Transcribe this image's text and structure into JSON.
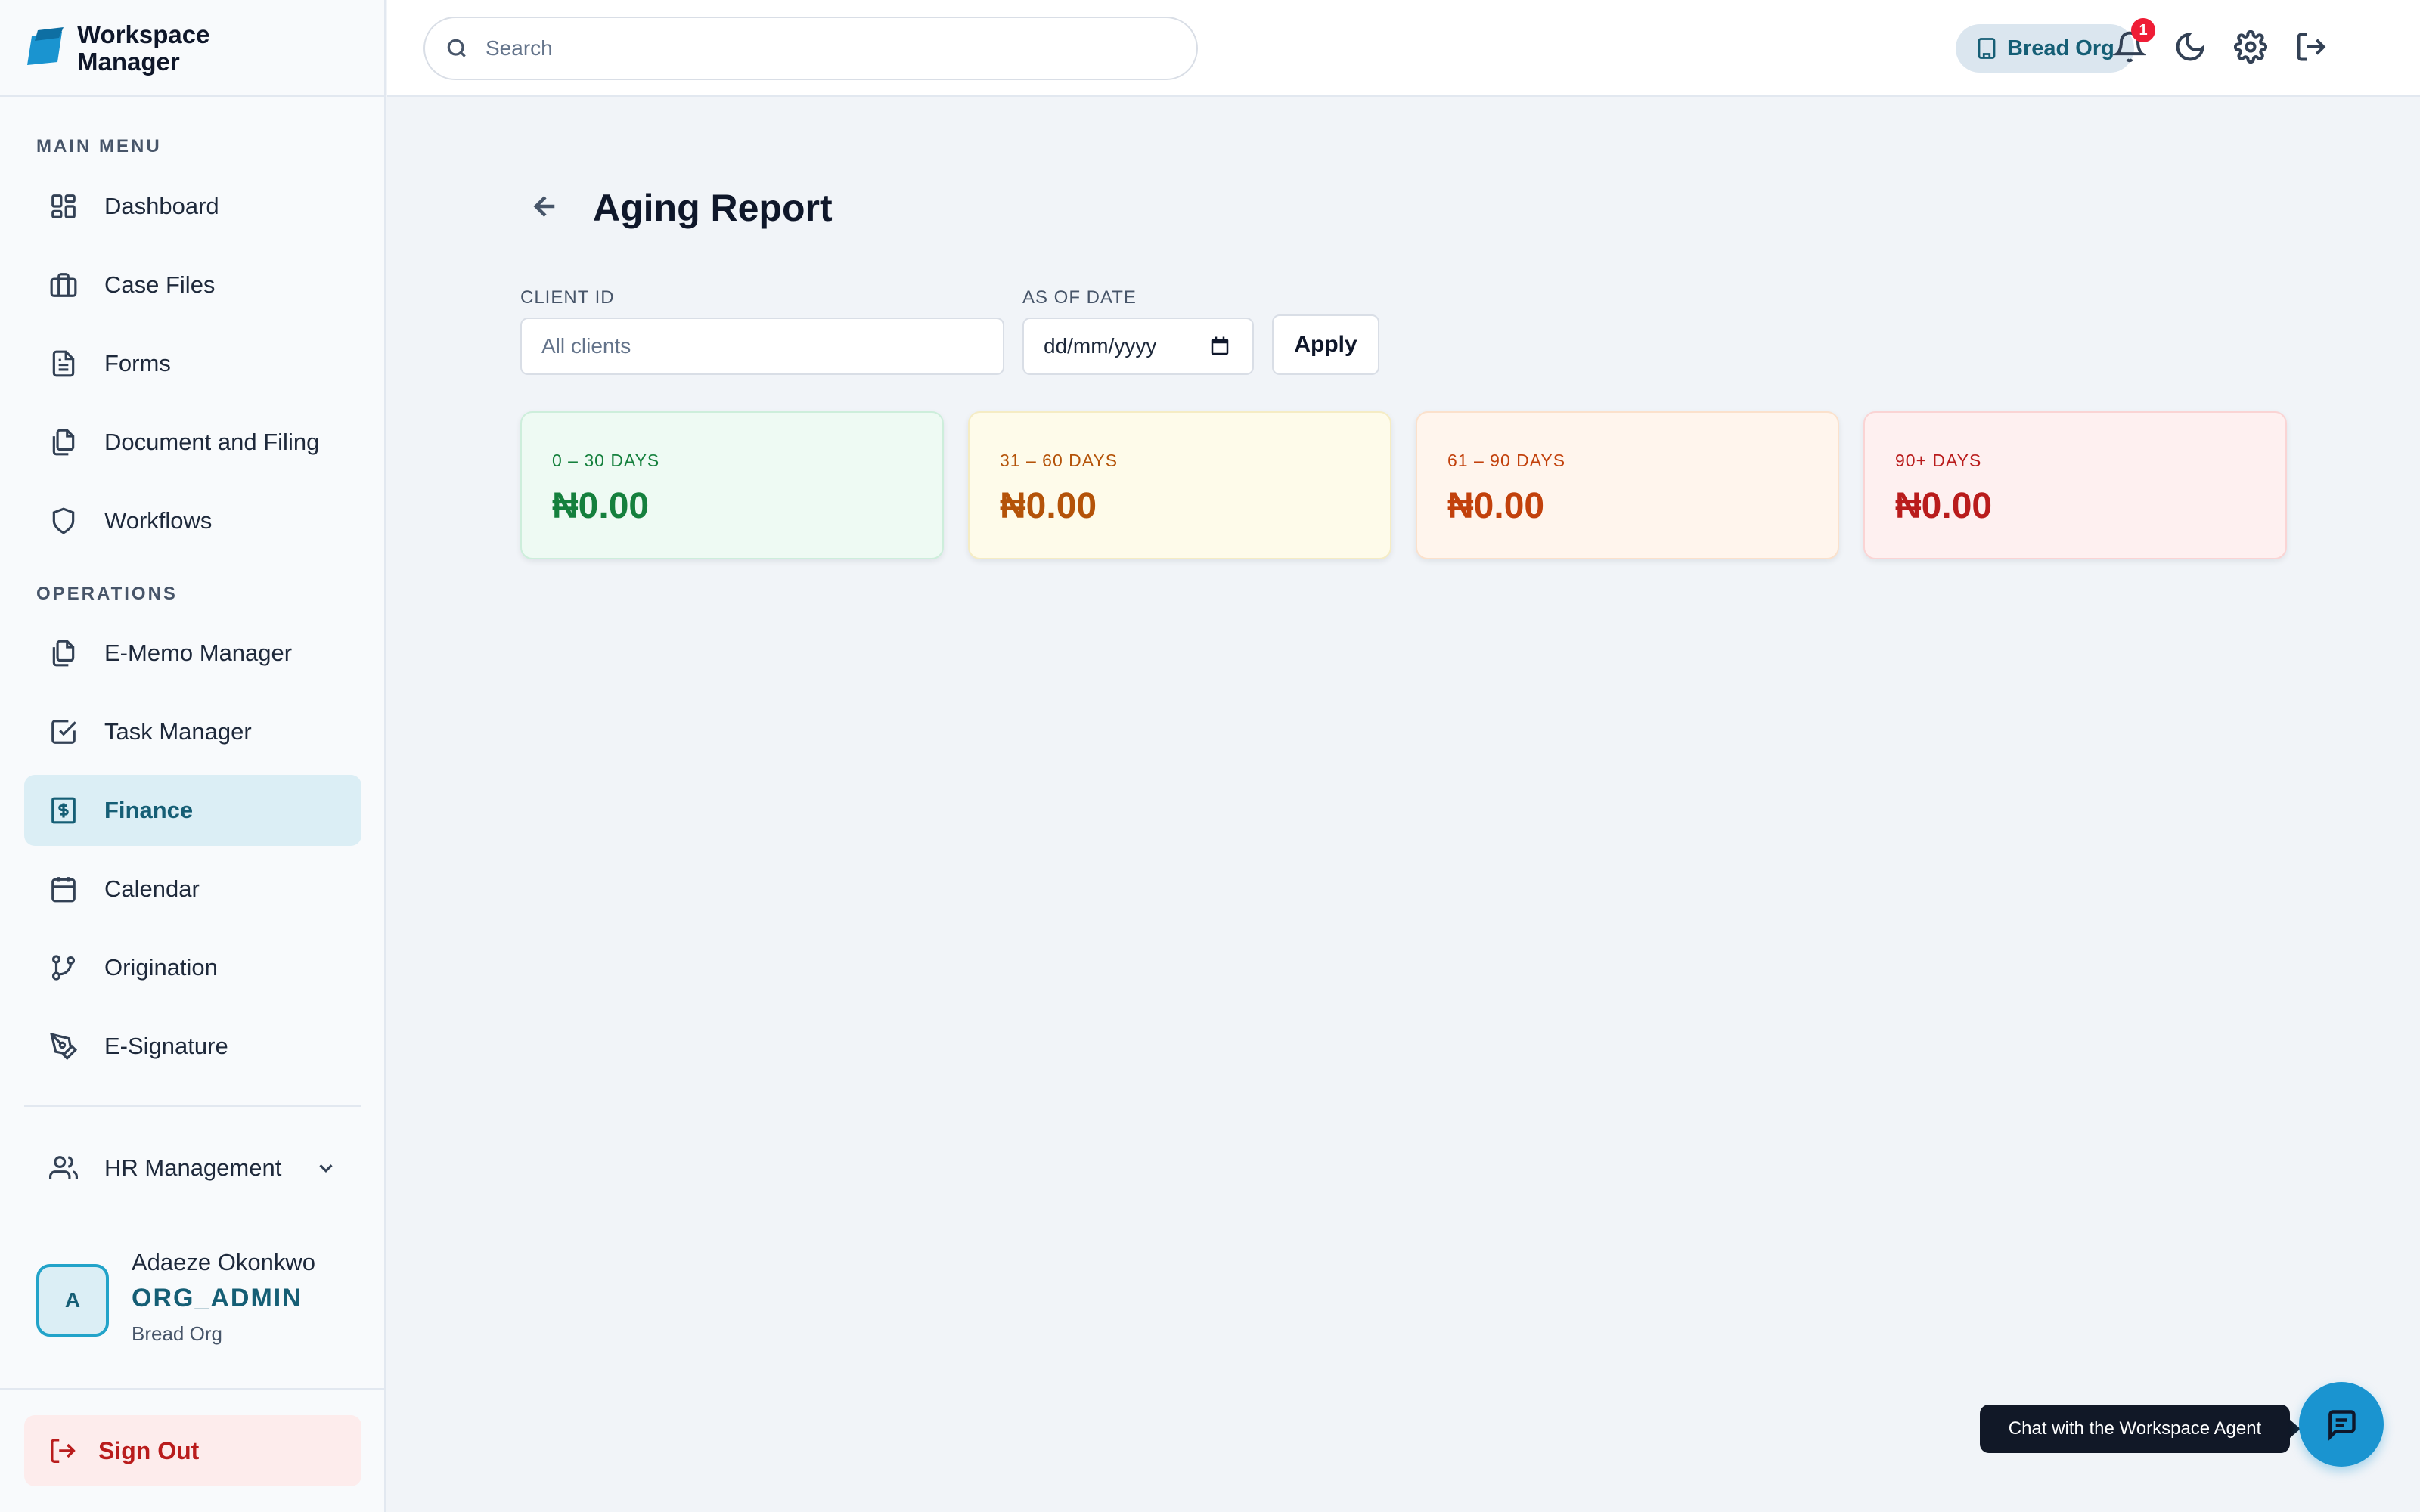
{
  "app": {
    "name": "Workspace Manager"
  },
  "sidebar": {
    "sections": [
      {
        "title": "MAIN MENU"
      },
      {
        "title": "OPERATIONS"
      }
    ],
    "items": [
      {
        "label": "Dashboard",
        "icon": "grid-icon"
      },
      {
        "label": "Case Files",
        "icon": "briefcase-icon"
      },
      {
        "label": "Forms",
        "icon": "document-icon"
      },
      {
        "label": "Document and Filing",
        "icon": "files-icon"
      },
      {
        "label": "Workflows",
        "icon": "shield-icon"
      },
      {
        "label": "E-Memo Manager",
        "icon": "files-icon"
      },
      {
        "label": "Task Manager",
        "icon": "checkbox-icon"
      },
      {
        "label": "Finance",
        "icon": "dollar-receipt-icon",
        "active": true
      },
      {
        "label": "Calendar",
        "icon": "calendar-icon"
      },
      {
        "label": "Origination",
        "icon": "git-branch-icon"
      },
      {
        "label": "E-Signature",
        "icon": "pen-tool-icon"
      }
    ],
    "hr": {
      "label": "HR Management",
      "icon": "users-icon"
    },
    "user": {
      "initial": "A",
      "name": "Adaeze Okonkwo",
      "role": "ORG_ADMIN",
      "org": "Bread Org"
    },
    "signout_label": "Sign Out"
  },
  "header": {
    "search_placeholder": "Search",
    "org_name": "Bread Org",
    "notification_count": "1"
  },
  "page": {
    "title": "Aging Report",
    "filters": {
      "client_label": "CLIENT ID",
      "client_placeholder": "All clients",
      "date_label": "AS OF DATE",
      "date_placeholder": "dd/mm/yyyy",
      "apply_label": "Apply"
    },
    "buckets": [
      {
        "label": "0 – 30 DAYS",
        "value": "₦0.00",
        "text_color": "#15803d",
        "label_color": "#15803d",
        "bg": "#eefaf3",
        "border": "#cdeedb"
      },
      {
        "label": "31 – 60 DAYS",
        "value": "₦0.00",
        "text_color": "#b45309",
        "label_color": "#b45309",
        "bg": "#fefbea",
        "border": "#f5ecc4"
      },
      {
        "label": "61 – 90 DAYS",
        "value": "₦0.00",
        "text_color": "#c2410c",
        "label_color": "#c2410c",
        "bg": "#fff5ed",
        "border": "#fbe1cc"
      },
      {
        "label": "90+ DAYS",
        "value": "₦0.00",
        "text_color": "#b91c1c",
        "label_color": "#b91c1c",
        "bg": "#fef0f0",
        "border": "#fad4d4"
      }
    ]
  },
  "chat": {
    "tooltip": "Chat with the Workspace Agent"
  },
  "colors": {
    "accent": "#155e75",
    "active_bg": "#dbeef5",
    "chat_button": "#1a94d0",
    "badge": "#ef1d36",
    "signout": "#b91c1c"
  }
}
